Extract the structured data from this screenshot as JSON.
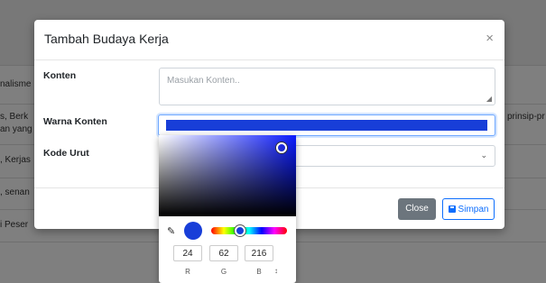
{
  "background": {
    "left_texts": [
      "nalisme",
      "s, Berk",
      "an yang",
      ", Kerjas",
      ", senan",
      "i Peser"
    ],
    "right_text": "prinsip-pr"
  },
  "modal": {
    "title": "Tambah Budaya Kerja",
    "close_symbol": "×",
    "fields": {
      "konten_label": "Konten",
      "konten_placeholder": "Masukan Konten..",
      "warna_label": "Warna Konten",
      "warna_value": "#183ed8",
      "kode_label": "Kode Urut"
    },
    "buttons": {
      "close": "Close",
      "save": "Simpan"
    }
  },
  "color_picker": {
    "rgb_values": {
      "r": "24",
      "g": "62",
      "b": "216"
    },
    "channel_labels": {
      "r": "R",
      "g": "G",
      "b": "B"
    },
    "mode_toggle": "↕"
  },
  "colors": {
    "selected": "#183ed8",
    "primary": "#0d6efd",
    "secondary": "#6c757d"
  }
}
